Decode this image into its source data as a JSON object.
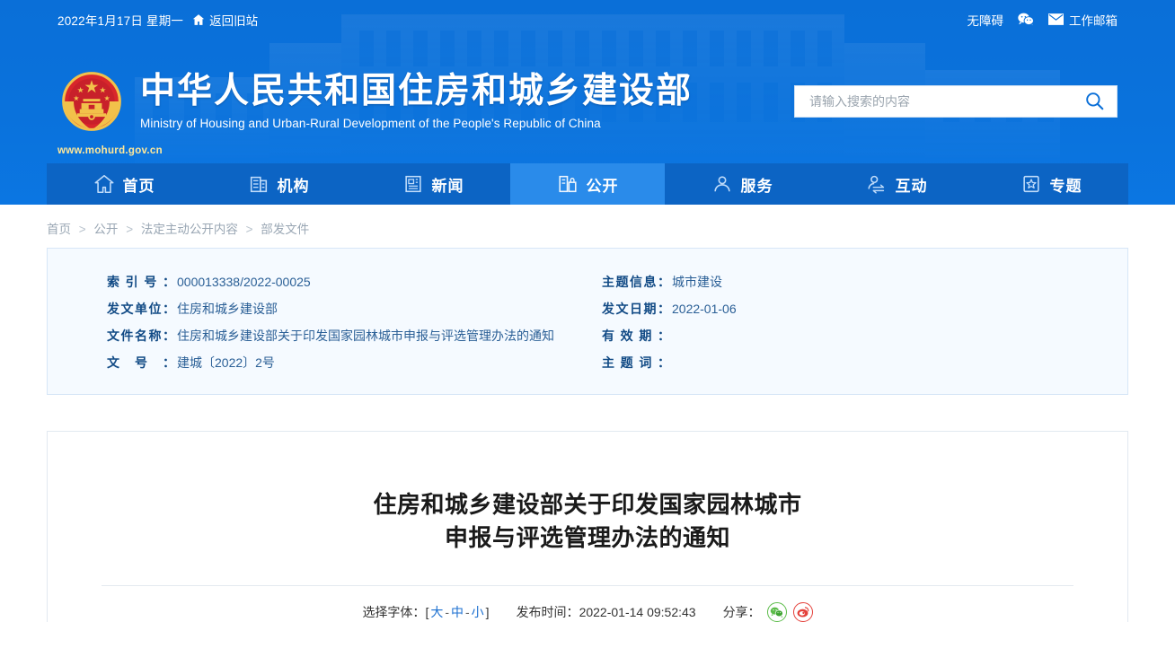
{
  "topbar": {
    "date": "2022年1月17日 星期一",
    "old_site_label": "返回旧站",
    "accessibility_label": "无障碍",
    "wechat_icon": "wechat-icon",
    "mail_icon": "mail-icon",
    "mail_label": "工作邮箱",
    "home_icon": "home-icon"
  },
  "brand": {
    "emblem": "national-emblem-icon",
    "name_cn": "中华人民共和国住房和城乡建设部",
    "name_en": "Ministry of Housing and Urban-Rural Development of the People's Republic of China",
    "url": "www.mohurd.gov.cn"
  },
  "search": {
    "placeholder": "请输入搜索的内容",
    "value": "",
    "icon": "search-icon"
  },
  "nav": {
    "items": [
      {
        "label": "首页",
        "icon": "home-icon",
        "active": false
      },
      {
        "label": "机构",
        "icon": "building-icon",
        "active": false
      },
      {
        "label": "新闻",
        "icon": "news-icon",
        "active": false
      },
      {
        "label": "公开",
        "icon": "open-document-icon",
        "active": true
      },
      {
        "label": "服务",
        "icon": "person-service-icon",
        "active": false
      },
      {
        "label": "互动",
        "icon": "person-exchange-icon",
        "active": false
      },
      {
        "label": "专题",
        "icon": "star-topic-icon",
        "active": false
      }
    ]
  },
  "breadcrumb": {
    "items": [
      "首页",
      "公开",
      "法定主动公开内容",
      "部发文件"
    ],
    "separator": ">"
  },
  "meta": {
    "left": [
      {
        "label": "索引号",
        "value": "000013338/2022-00025"
      },
      {
        "label": "发文单位",
        "value": "住房和城乡建设部"
      },
      {
        "label": "文件名称",
        "value": "住房和城乡建设部关于印发国家园林城市申报与评选管理办法的通知"
      },
      {
        "label": "文号",
        "value": "建城〔2022〕2号"
      }
    ],
    "right": [
      {
        "label": "主题信息",
        "value": "城市建设"
      },
      {
        "label": "发文日期",
        "value": "2022-01-06"
      },
      {
        "label": "有效期",
        "value": ""
      },
      {
        "label": "主题词",
        "value": ""
      }
    ]
  },
  "article": {
    "title_line1": "住房和城乡建设部关于印发国家园林城市",
    "title_line2": "申报与评选管理办法的通知",
    "fontsize_label": "选择字体：",
    "bracket_open": "[",
    "bracket_close": "]",
    "size_large": "大",
    "size_medium": "中",
    "size_small": "小",
    "dash": "-",
    "publish_label": "发布时间：",
    "publish_time": "2022-01-14 09:52:43",
    "share_label": "分享：",
    "share_wechat_icon": "wechat-share-icon",
    "share_weibo_icon": "weibo-share-icon"
  },
  "colors": {
    "header_blue": "#0a72dc",
    "nav_blue": "#0c64c4",
    "nav_active": "#2a8bea",
    "link_blue": "#1b6fd0",
    "meta_bg": "#f5faff",
    "meta_border": "#d7e6f7"
  }
}
